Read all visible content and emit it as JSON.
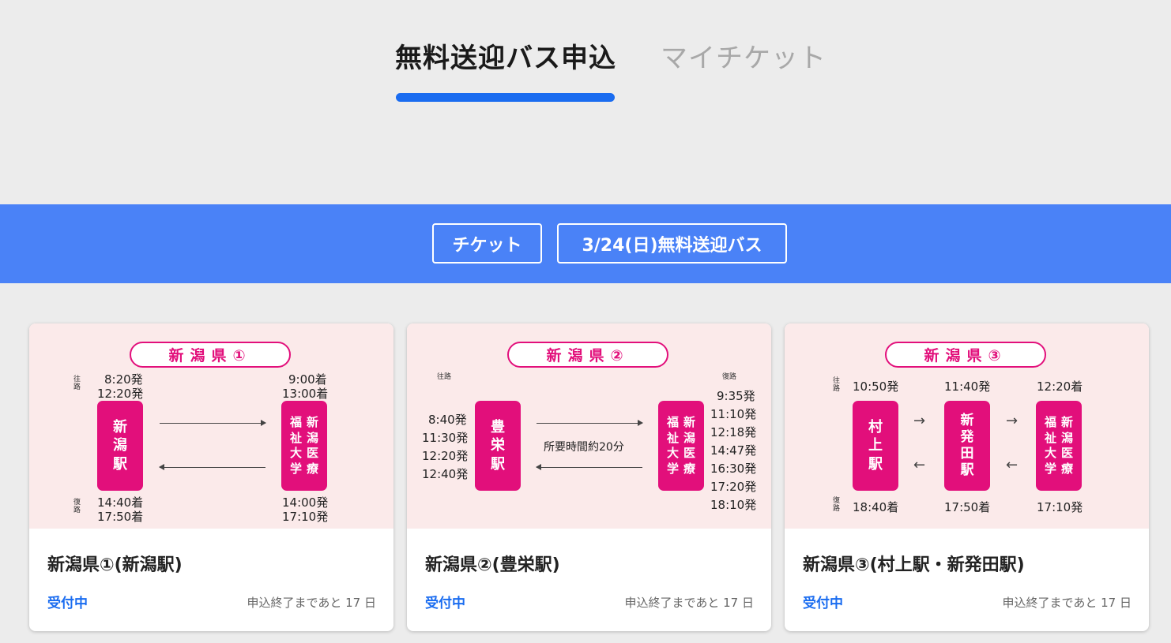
{
  "tabs": {
    "apply": "無料送迎バス申込",
    "my_ticket": "マイチケット"
  },
  "breadcrumb": {
    "ticket": "チケット",
    "event": "3/24(日)無料送迎バス"
  },
  "cards": [
    {
      "pill": "新潟県①",
      "title": "新潟県①(新潟駅)",
      "status": "受付中",
      "deadline": "申込終了まであと 17 日",
      "route": {
        "outbound_label": "往路",
        "return_label": "復路",
        "origin": [
          "新",
          "潟",
          "駅"
        ],
        "dest_col1": [
          "福",
          "祉",
          "大",
          "学"
        ],
        "dest_col2": [
          "新",
          "潟",
          "医",
          "療"
        ],
        "dep_out": [
          "8:20発",
          "12:20発"
        ],
        "arr_out": [
          "9:00着",
          "13:00着"
        ],
        "arr_ret": [
          "14:40着",
          "17:50着"
        ],
        "dep_ret": [
          "14:00発",
          "17:10発"
        ]
      }
    },
    {
      "pill": "新潟県②",
      "title": "新潟県②(豊栄駅)",
      "status": "受付中",
      "deadline": "申込終了まであと 17 日",
      "route": {
        "outbound_label": "往路",
        "return_label": "復路",
        "origin": [
          "豊",
          "栄",
          "駅"
        ],
        "dest_col1": [
          "福",
          "祉",
          "大",
          "学"
        ],
        "dest_col2": [
          "新",
          "潟",
          "医",
          "療"
        ],
        "dep_out": [
          "8:40発",
          "11:30発",
          "12:20発",
          "12:40発"
        ],
        "note": "所要時間約20分",
        "dep_ret": [
          "9:35発",
          "11:10発",
          "12:18発",
          "14:47発",
          "16:30発",
          "17:20発",
          "18:10発"
        ]
      }
    },
    {
      "pill": "新潟県③",
      "title": "新潟県③(村上駅・新発田駅)",
      "status": "受付中",
      "deadline": "申込終了まであと 17 日",
      "route": {
        "outbound_label": "往路",
        "return_label": "復路",
        "stn1": [
          "村",
          "上",
          "駅"
        ],
        "stn2": [
          "新",
          "発",
          "田",
          "駅"
        ],
        "dest_col1": [
          "福",
          "祉",
          "大",
          "学"
        ],
        "dest_col2": [
          "新",
          "潟",
          "医",
          "療"
        ],
        "t_out": [
          "10:50発",
          "11:40発",
          "12:20着"
        ],
        "t_ret": [
          "18:40着",
          "17:50着",
          "17:10発"
        ]
      }
    }
  ]
}
